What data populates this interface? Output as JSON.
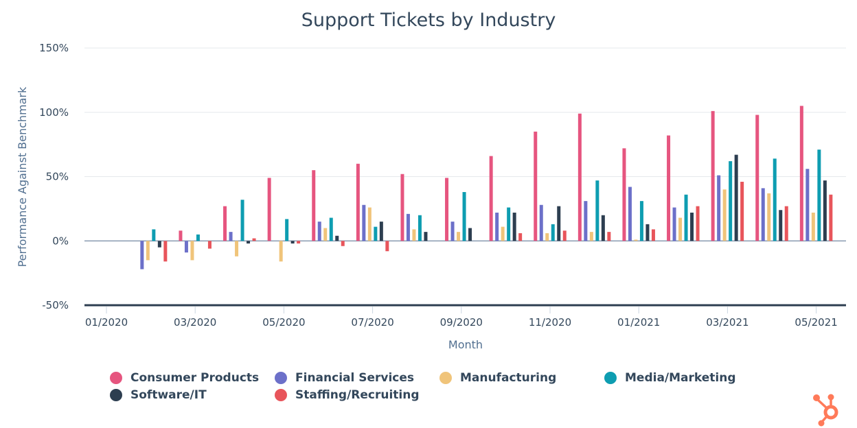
{
  "chart_data": {
    "type": "bar",
    "title": "Support Tickets by Industry",
    "xlabel": "Month",
    "ylabel": "Performance Against Benchmark",
    "ylim": [
      -50,
      150
    ],
    "yticks": [
      "150%",
      "100%",
      "50%",
      "0%",
      "-50%"
    ],
    "ytick_values": [
      150,
      100,
      50,
      0,
      -50
    ],
    "grid": true,
    "legend_position": "bottom",
    "categories": [
      "01/2020",
      "02/2020",
      "03/2020",
      "04/2020",
      "05/2020",
      "06/2020",
      "07/2020",
      "08/2020",
      "09/2020",
      "10/2020",
      "11/2020",
      "12/2020",
      "01/2021",
      "02/2021",
      "03/2021",
      "04/2021",
      "05/2021"
    ],
    "xtick_labels": [
      "01/2020",
      "03/2020",
      "05/2020",
      "07/2020",
      "09/2020",
      "11/2020",
      "01/2021",
      "03/2021",
      "05/2021"
    ],
    "series": [
      {
        "name": "Consumer Products",
        "color": "#e6557f",
        "values": [
          0,
          0,
          8,
          27,
          49,
          55,
          60,
          52,
          49,
          66,
          85,
          99,
          72,
          82,
          101,
          98,
          105
        ]
      },
      {
        "name": "Financial Services",
        "color": "#6c70c9",
        "values": [
          0,
          -22,
          -9,
          7,
          0,
          15,
          28,
          21,
          15,
          22,
          28,
          31,
          42,
          26,
          51,
          41,
          56
        ]
      },
      {
        "name": "Manufacturing",
        "color": "#f0c47a",
        "values": [
          0,
          -15,
          -15,
          -12,
          -16,
          10,
          26,
          9,
          7,
          11,
          6,
          7,
          1,
          18,
          40,
          37,
          22
        ]
      },
      {
        "name": "Media/Marketing",
        "color": "#0e9db1",
        "values": [
          0,
          9,
          5,
          32,
          17,
          18,
          11,
          20,
          38,
          26,
          13,
          47,
          31,
          36,
          62,
          64,
          71
        ]
      },
      {
        "name": "Software/IT",
        "color": "#2d3e50",
        "values": [
          0,
          -5,
          0,
          -2,
          -2,
          4,
          15,
          7,
          10,
          22,
          27,
          20,
          13,
          22,
          67,
          24,
          47
        ]
      },
      {
        "name": "Staffing/Recruiting",
        "color": "#e8555b",
        "values": [
          0,
          -16,
          -6,
          2,
          -2,
          -4,
          -8,
          0,
          0,
          6,
          8,
          7,
          9,
          27,
          46,
          27,
          36
        ]
      }
    ]
  },
  "logo": {
    "name": "hubspot-sprocket",
    "color": "#ff7a59"
  }
}
